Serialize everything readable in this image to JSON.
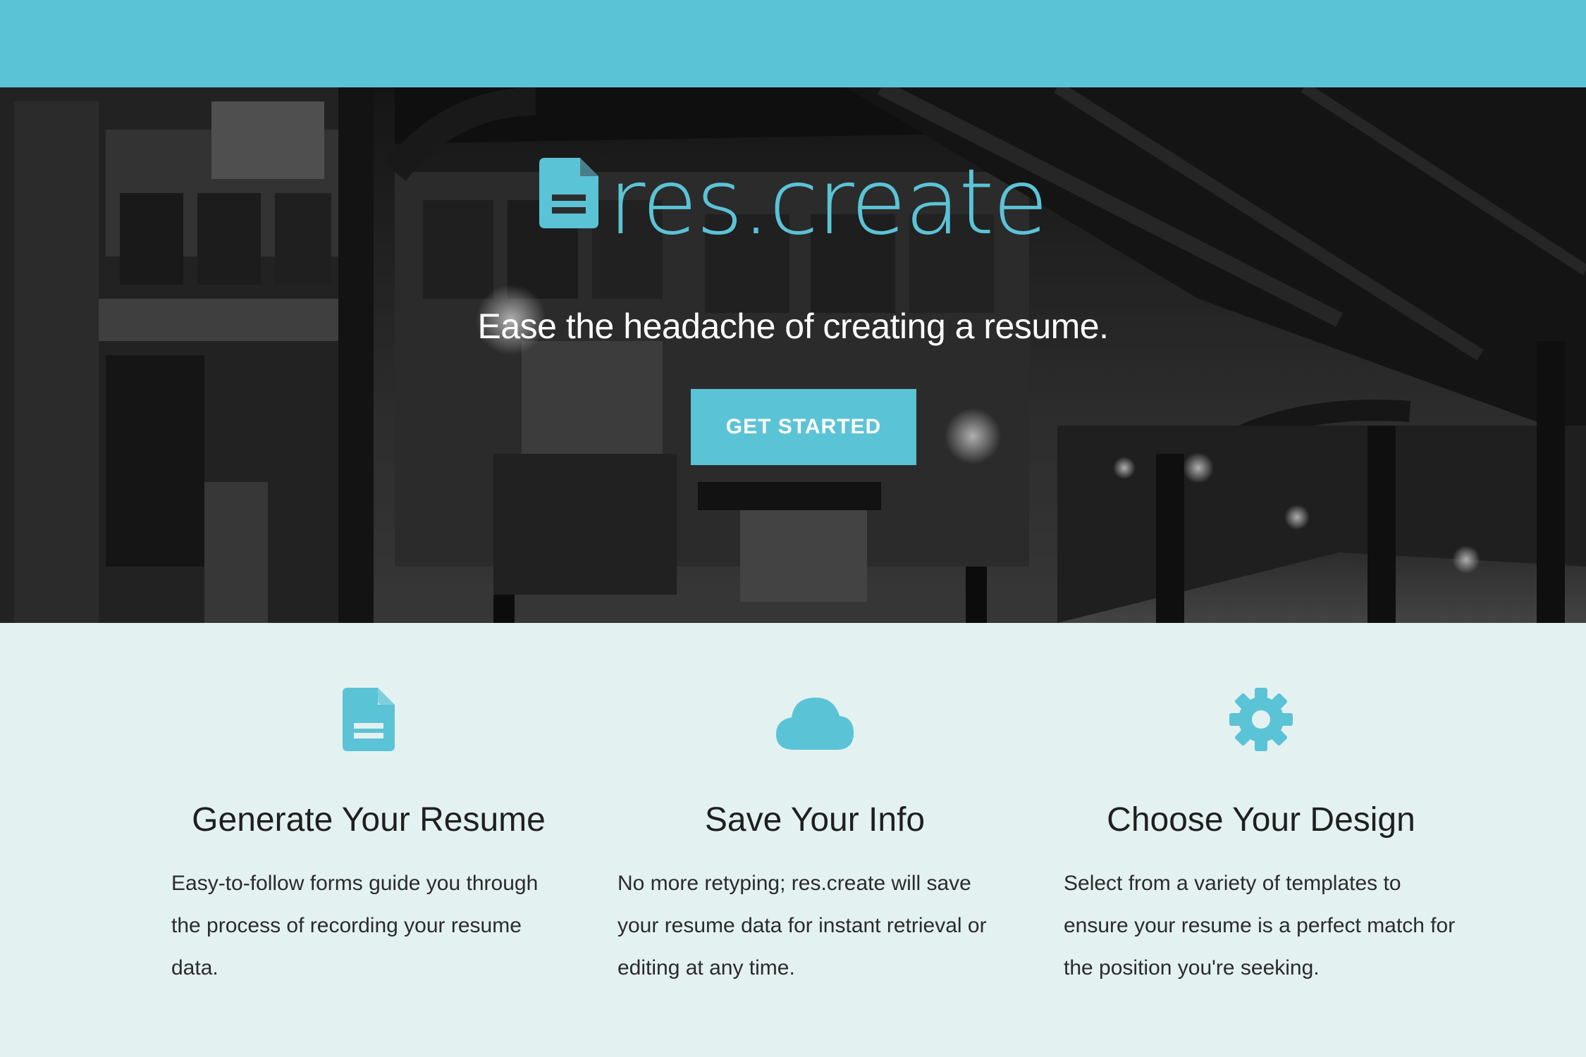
{
  "header": {},
  "hero": {
    "brand_name": "res.create",
    "brand_icon": "document-icon",
    "tagline": "Ease the headache of creating a resume.",
    "cta_label": "GET STARTED"
  },
  "features": [
    {
      "icon": "document-icon",
      "title": "Generate Your Resume",
      "description": "Easy-to-follow forms guide you through the process of recording your resume data."
    },
    {
      "icon": "cloud-icon",
      "title": "Save Your Info",
      "description": "No more retyping; res.create will save your resume data for instant retrieval or editing at any time."
    },
    {
      "icon": "gear-icon",
      "title": "Choose Your Design",
      "description": "Select from a variety of templates to ensure your resume is a perfect match for the position you're seeking."
    }
  ],
  "colors": {
    "accent": "#5bc3d6",
    "section_bg": "#e4f1f1",
    "hero_text": "#ffffff",
    "body_text": "#2b2b2b"
  }
}
